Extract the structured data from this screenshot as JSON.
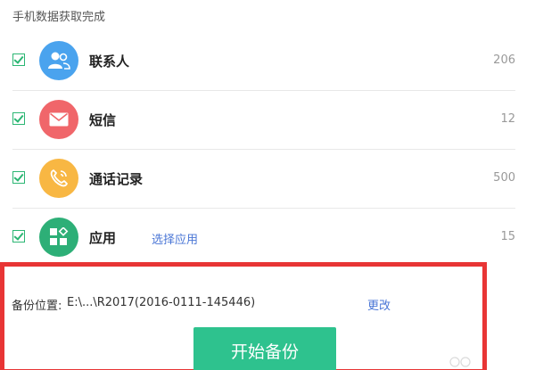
{
  "header": {
    "status": "手机数据获取完成"
  },
  "items": [
    {
      "label": "联系人",
      "count": "206",
      "color": "#4aa3ee",
      "icon": "contacts-icon",
      "checked": true
    },
    {
      "label": "短信",
      "count": "12",
      "color": "#f0666a",
      "icon": "message-icon",
      "checked": true
    },
    {
      "label": "通话记录",
      "count": "500",
      "color": "#f8b743",
      "icon": "phone-icon",
      "checked": true
    },
    {
      "label": "应用",
      "count": "15",
      "color": "#2daf77",
      "icon": "apps-icon",
      "checked": true,
      "link": "选择应用"
    }
  ],
  "backup": {
    "location_label": "备份位置:",
    "location_value": "E:\\...\\R2017(2016-0111-145446)",
    "change_label": "更改",
    "start_label": "开始备份",
    "highlight_color": "#e83535",
    "button_color": "#2ec28e"
  }
}
